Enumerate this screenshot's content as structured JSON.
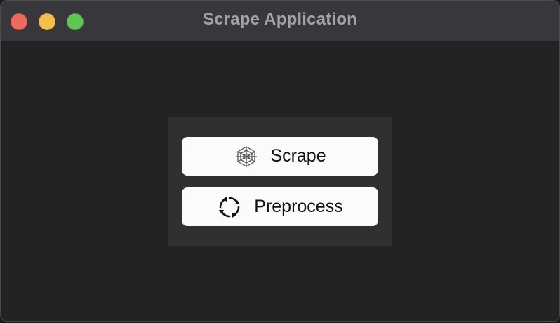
{
  "window": {
    "title": "Scrape Application"
  },
  "buttons": {
    "scrape_label": "Scrape",
    "scrape_icon": "spider-web-icon",
    "preprocess_label": "Preprocess",
    "preprocess_icon": "refresh-cycle-icon"
  },
  "colors": {
    "window_bg": "#232323",
    "titlebar_bg": "#38373c",
    "panel_bg": "#303030",
    "button_bg": "#fbfbfb",
    "close": "#ed6a5e",
    "minimize": "#f5bf4f",
    "zoom": "#61c554"
  }
}
